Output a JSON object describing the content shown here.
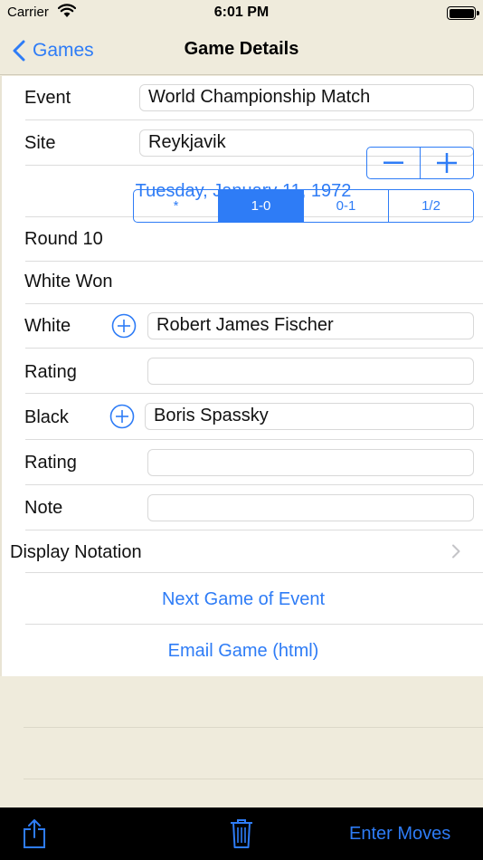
{
  "status_bar": {
    "carrier": "Carrier",
    "time": "6:01 PM"
  },
  "nav": {
    "back_label": "Games",
    "title": "Game Details"
  },
  "form": {
    "event": {
      "label": "Event",
      "value": "World Championship Match"
    },
    "site": {
      "label": "Site",
      "value": "Reykjavik"
    },
    "date": "Tuesday, January 11, 1972",
    "round": {
      "label": "Round 10"
    },
    "result": {
      "label": "White Won",
      "options": [
        "*",
        "1-0",
        "0-1",
        "1/2"
      ],
      "selected": "1-0"
    },
    "white": {
      "label": "White",
      "value": "Robert James Fischer"
    },
    "white_rating": {
      "label": "Rating",
      "value": ""
    },
    "black": {
      "label": "Black",
      "value": "Boris Spassky"
    },
    "black_rating": {
      "label": "Rating",
      "value": ""
    },
    "note": {
      "label": "Note",
      "value": ""
    }
  },
  "display_notation": "Display Notation",
  "actions": {
    "next_game": "Next Game of Event",
    "email_game": "Email Game (html)"
  },
  "toolbar": {
    "share_icon": "share-icon",
    "trash_icon": "trash-icon",
    "enter_moves": "Enter Moves"
  },
  "colors": {
    "accent": "#2e7cf6",
    "background": "#efebdc",
    "toolbar": "#000000"
  }
}
